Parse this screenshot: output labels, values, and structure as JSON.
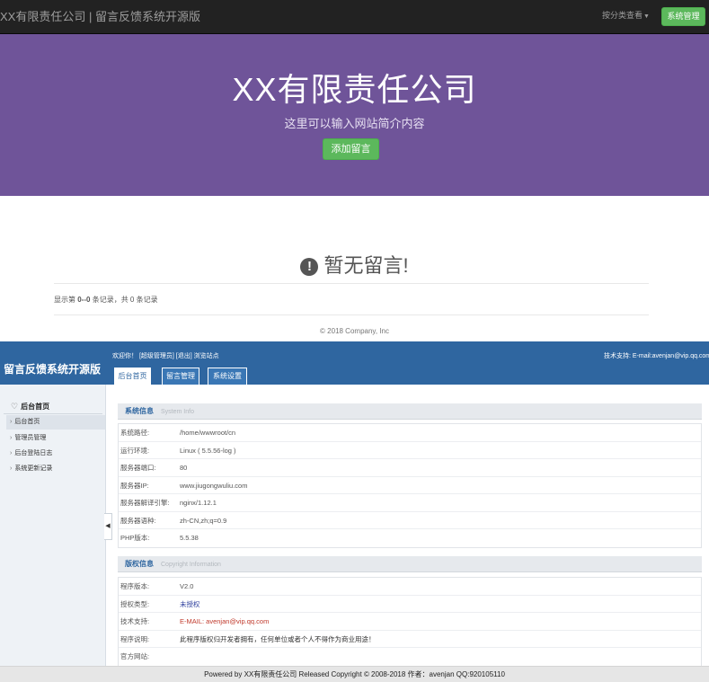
{
  "front": {
    "brand": "XX有限责任公司 | 留言反馈系统开源版",
    "category_menu": "按分类查看",
    "sys_button": "系统管理",
    "hero_title": "XX有限责任公司",
    "hero_subtitle": "这里可以输入网站简介内容",
    "add_button": "添加留言",
    "empty_message": "暂无留言!",
    "record_info": {
      "prefix": "显示第 ",
      "range": "0--0",
      "suffix": " 条记录，共 0 条记录"
    },
    "footer": "© 2018 Company, Inc"
  },
  "admin": {
    "logo": "留言反馈系统开源版",
    "links": {
      "welcome": "欢迎你！",
      "user": "[超级管理员]",
      "logout": "[退出]",
      "browse": "浏览站点"
    },
    "support": "技术支持: E-mail:avenjan@vip.qq.com",
    "tabs": [
      "后台首页",
      "留言管理",
      "系统设置"
    ],
    "sidebar": {
      "title": "后台首页",
      "items": [
        "后台首页",
        "管理员管理",
        "后台登陆日志",
        "系统更新记录"
      ]
    },
    "sys_info": {
      "title": "系统信息",
      "subtitle": "System   Info",
      "rows": [
        {
          "k": "系统路径:",
          "v": "/home/wwwroot/cn"
        },
        {
          "k": "运行环境:",
          "v": "Linux ( 5.5.56-log )"
        },
        {
          "k": "服务器端口:",
          "v": "80"
        },
        {
          "k": "服务器IP:",
          "v": "www.jiugongwuliu.com"
        },
        {
          "k": "服务器解译引擎:",
          "v": "nginx/1.12.1"
        },
        {
          "k": "服务器语种:",
          "v": "zh-CN,zh;q=0.9"
        },
        {
          "k": "PHP版本:",
          "v": "5.5.38"
        }
      ]
    },
    "copyright_info": {
      "title": "版权信息",
      "subtitle": "Copyright Information",
      "rows": [
        {
          "k": "程序版本:",
          "v": "V2.0"
        },
        {
          "k": "授权类型:",
          "v": "未授权"
        },
        {
          "k": "技术支持:",
          "v": "E-MAIL: avenjan@vip.qq.com"
        },
        {
          "k": "程序说明:",
          "v": "此程序版权归开发者拥有，任何单位或者个人不得作为商业用途！"
        },
        {
          "k": "官方网站:",
          "v": ""
        }
      ]
    },
    "footer": "Powered by XX有限责任公司  Released Copyright © 2008-2018 作者：avenjan QQ:920105110"
  },
  "colors": {
    "navbar": "#222222",
    "hero": "#6f5499",
    "success": "#5cb85c",
    "admin_blue": "#2f66a0"
  }
}
